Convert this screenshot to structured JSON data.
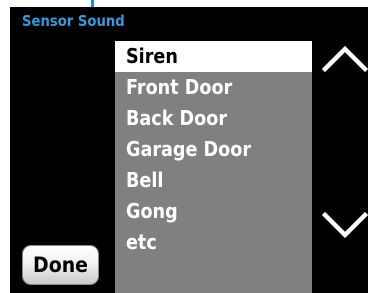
{
  "screen": {
    "title": "Sensor Sound"
  },
  "sound_list": {
    "selected_index": 0,
    "items": [
      {
        "label": "Siren"
      },
      {
        "label": "Front Door"
      },
      {
        "label": "Back Door"
      },
      {
        "label": "Garage Door"
      },
      {
        "label": "Bell"
      },
      {
        "label": "Gong"
      },
      {
        "label": "etc"
      }
    ]
  },
  "controls": {
    "done_label": "Done",
    "scroll_up_icon": "chevron-up-icon",
    "scroll_down_icon": "chevron-down-icon"
  },
  "colors": {
    "title": "#3a9ad9",
    "background": "#000000",
    "list_background": "#808080",
    "selected_background": "#ffffff"
  }
}
